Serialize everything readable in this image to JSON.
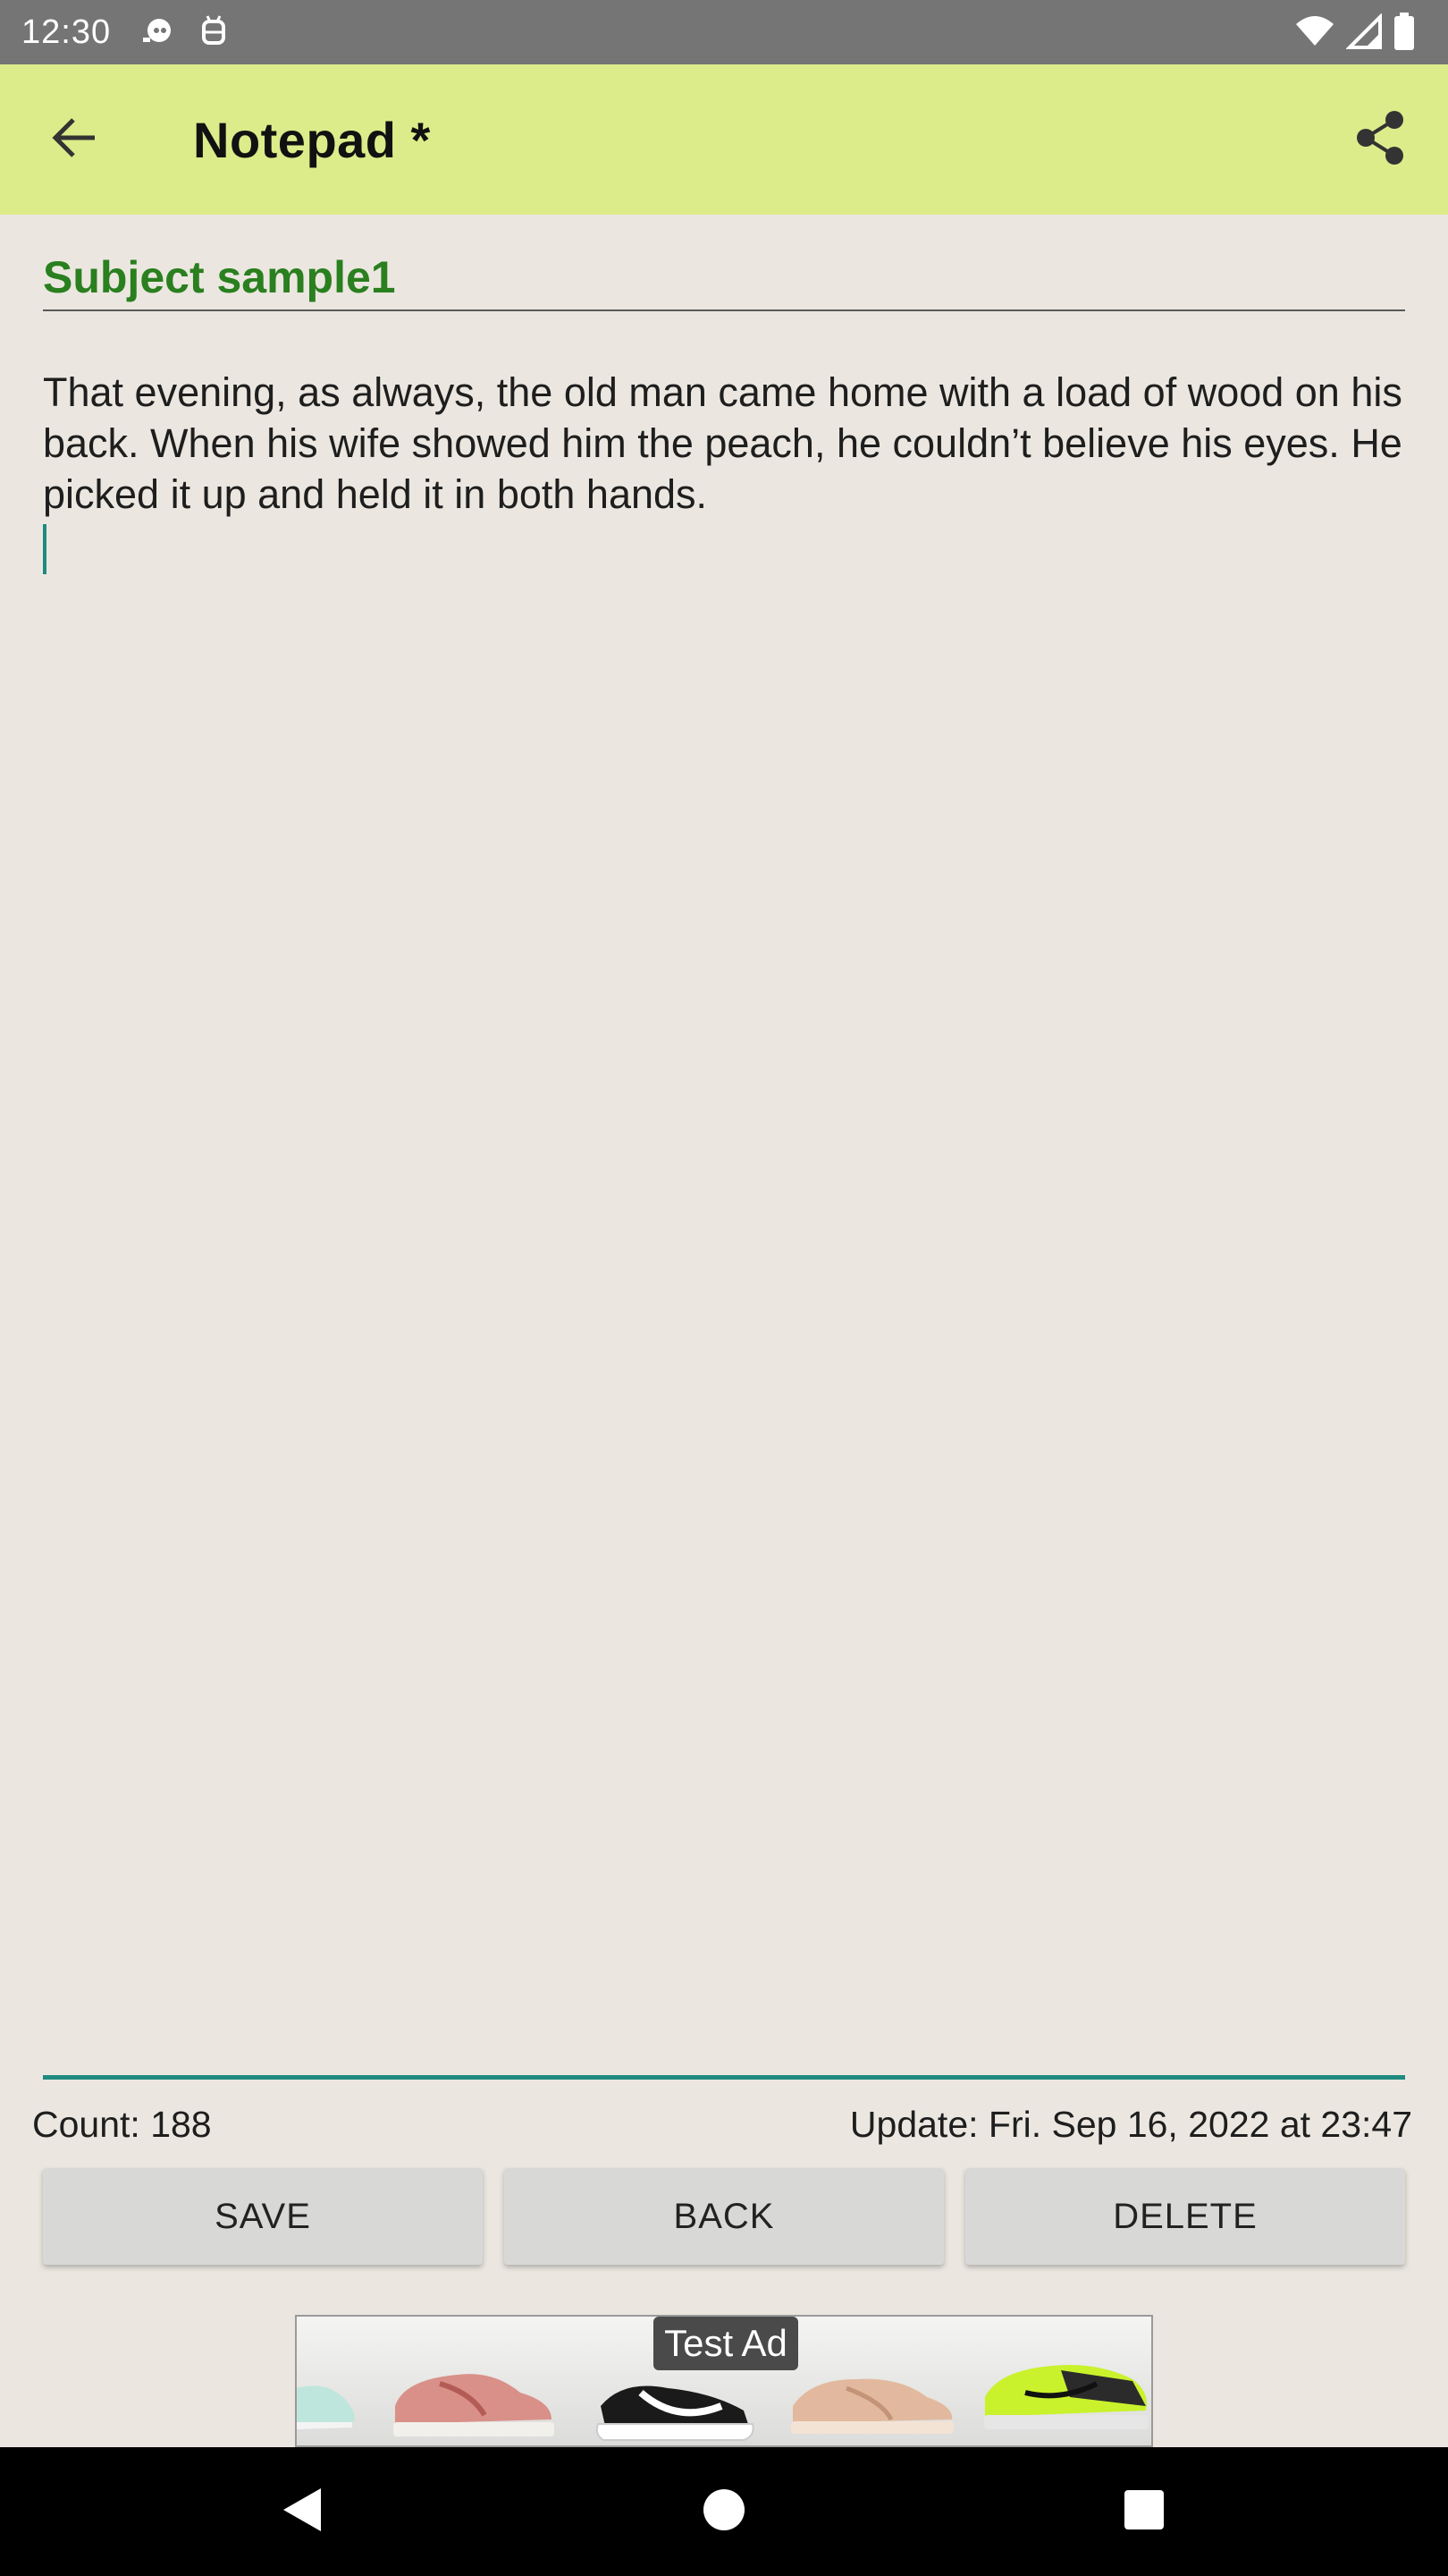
{
  "status_bar": {
    "time": "12:30",
    "icons": [
      "notification-icon",
      "android-debug-icon",
      "wifi-icon",
      "signal-icon",
      "battery-icon"
    ]
  },
  "app_bar": {
    "title": "Notepad *",
    "back_icon": "arrow-back-icon",
    "share_icon": "share-icon",
    "background": "#dcec8a"
  },
  "editor": {
    "subject": "Subject sample1",
    "subject_color": "#2a7f1f",
    "body": "That evening, as always, the old man came home with a load of wood on his back. When his wife showed him the peach, he couldn’t believe his eyes. He picked it up and held it in both hands.",
    "accent": "#1f8a80"
  },
  "footer": {
    "count": "Count: 188",
    "update": "Update: Fri. Sep 16, 2022 at 23:47"
  },
  "buttons": {
    "save": "SAVE",
    "back": "BACK",
    "delete": "DELETE"
  },
  "ad": {
    "label": "Test Ad"
  },
  "nav_bar": {
    "icons": [
      "nav-back-icon",
      "nav-home-icon",
      "nav-recents-icon"
    ]
  }
}
